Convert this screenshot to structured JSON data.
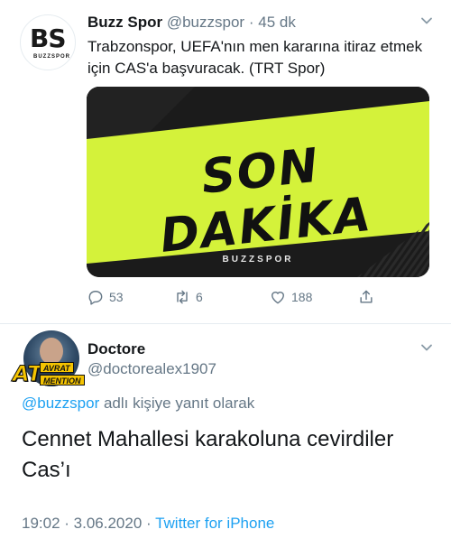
{
  "tweet": {
    "author_name": "Buzz Spor",
    "handle": "@buzzspor",
    "time_separator": "·",
    "time": "45 dk",
    "text": "Trabzonspor, UEFA'nın men kararına itiraz etmek için CAS'a başvuracak. (TRT Spor)",
    "avatar_logo": "BS",
    "avatar_sub": "BUZZSPOR",
    "media": {
      "headline": "SON DAKİKA",
      "brand": "BUZZSPOR",
      "accent_color": "#d4f23a",
      "background_color": "#1b1b1b"
    },
    "actions": {
      "replies": "53",
      "retweets": "6",
      "likes": "188"
    }
  },
  "reply": {
    "author_name": "Doctore",
    "handle": "@doctorealex1907",
    "badge_main": "AT",
    "badge_top": "AVRAT",
    "badge_bottom": "MENTION",
    "replying_mention": "@buzzspor",
    "replying_suffix": " adlı kişiye yanıt olarak",
    "text_line1": "Cennet Mahallesi karakoluna cevirdiler",
    "text_line2": "Cas’ı",
    "timestamp": "19:02 · 3.06.2020 · ",
    "source": "Twitter for iPhone"
  },
  "colors": {
    "link": "#1da1f2",
    "secondary_text": "#657786",
    "primary_text": "#14171a",
    "divider": "#e6ecf0"
  },
  "icons": [
    "chevron-down-icon",
    "reply-icon",
    "retweet-icon",
    "like-icon",
    "share-icon"
  ]
}
